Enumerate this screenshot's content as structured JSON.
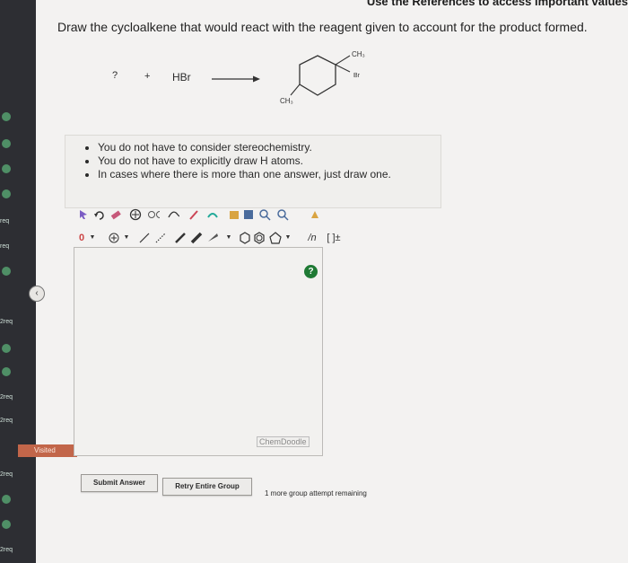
{
  "references_link": "Use the References to access important values",
  "question": {
    "prompt": "Draw the cycloalkene that would react with the reagent given to account for the product formed.",
    "reaction": {
      "unknown": "?",
      "plus": "+",
      "reagent": "HBr",
      "product_labels": [
        "CH₃",
        "Br",
        "CH₃"
      ]
    },
    "notes": [
      "You do not have to consider stereochemistry.",
      "You do not have to explicitly draw H atoms.",
      "In cases where there is more than one answer, just draw one."
    ]
  },
  "editor": {
    "charge_label": "0",
    "help_label": "?",
    "watermark": "ChemDoodle",
    "chain_label": "/n",
    "bracket_label": "[ ]±",
    "tools_row1": [
      "pointer-icon",
      "undo-icon",
      "eraser-icon",
      "zoom-fit-icon",
      "template-icon",
      "lasso-icon",
      "copy-icon",
      "paste-icon",
      "zoom-in-icon",
      "zoom-out-icon",
      "clean-icon"
    ],
    "tools_row2": [
      "charge-icon",
      "add-atom-icon",
      "single-bond-icon",
      "double-bond-icon",
      "triple-bond-icon",
      "wedge-bond-icon",
      "ring-icon",
      "chain-icon"
    ]
  },
  "sidebar": {
    "items": [
      {
        "label": "req"
      },
      {
        "label": "req"
      },
      {
        "label": "2req"
      },
      {
        "label": "2req"
      },
      {
        "label": "2req"
      },
      {
        "label": "2req"
      },
      {
        "label": "2req"
      }
    ],
    "visited_label": "Visited"
  },
  "actions": {
    "submit": "Submit Answer",
    "retry": "Retry Entire Group",
    "attempts": "1 more group attempt remaining"
  },
  "colors": {
    "sidebar": "#2d2e33",
    "status_green": "#4f8f66",
    "visited": "#c2664a",
    "help": "#1f7a34"
  }
}
